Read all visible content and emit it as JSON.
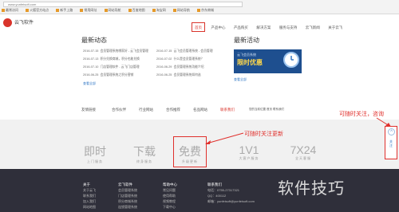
{
  "browser": {
    "url": "www.yunfeisoft.com",
    "bookmarks": [
      "最常访问",
      "火狐官方站点",
      "新手上路",
      "常用网址",
      "网站导航",
      "百度地图",
      "淘宝网",
      "网站导航",
      "京东商城",
      "网址大全",
      "收藏夹栏",
      "网址合集",
      "网上都在",
      "美乐乐中国-专业..."
    ]
  },
  "header": {
    "logo_text": "云飞软件",
    "nav": [
      "首页",
      "产品中心",
      "产品购买",
      "解决方案",
      "服务与支持",
      "云飞新闻",
      "关于云飞"
    ],
    "top_links": [
      "云飞客服",
      "收藏云飞"
    ]
  },
  "news": {
    "title": "最新动态",
    "items": [
      {
        "date": "2016-07-15",
        "text": "会员管理系统哪家好 - 云飞会员管理"
      },
      {
        "date": "2016-07-13",
        "text": "积分兑换商城，积分也能兑换"
      },
      {
        "date": "2016-07-10",
        "text": "门店管理软件 - 云飞门店管理"
      },
      {
        "date": "2016-06-25",
        "text": "会员管理系统之积分营销"
      },
      {
        "date": "2016-07-15",
        "text": "云飞会员管理系统 - 会员管理"
      },
      {
        "date": "2016-07-02",
        "text": "什么是会员管理系统？"
      },
      {
        "date": "2016-06-29",
        "text": "会员管理系统功能介绍"
      },
      {
        "date": "2016-06-25",
        "text": "会员管理系统如何选"
      }
    ],
    "more": "查看全部"
  },
  "activity": {
    "title": "最新活动",
    "banner_top": "云飞会员系统",
    "banner_main": "限时优惠",
    "more": "查看全部"
  },
  "links": [
    "友情链接",
    "合作伙伴",
    "行业网站",
    "合作推荐",
    "名品网站",
    "联系我们"
  ],
  "links_right": "您的当前位置 首页 联系我们",
  "features": [
    {
      "big": "即时",
      "small": "上门服务"
    },
    {
      "big": "下载",
      "small": "终身服务"
    },
    {
      "big": "免费",
      "small": "升级更新"
    },
    {
      "big": "1V1",
      "small": "大客户服务"
    },
    {
      "big": "7X24",
      "small": "全天客服"
    }
  ],
  "footer": {
    "cols": [
      {
        "h": "关于",
        "items": [
          "关于云飞",
          "联系我们",
          "加入我们",
          "网站地图"
        ]
      },
      {
        "h": "云飞软件",
        "items": [
          "会员管理系统",
          "门店管理系统",
          "积分商城系统",
          "连锁管理系统"
        ]
      },
      {
        "h": "帮助中心",
        "items": [
          "常见问题",
          "使用帮助",
          "视频教程",
          "下载中心"
        ]
      },
      {
        "h": "联系我们",
        "items": [
          "电话：0755-27317321",
          "QQ：400112",
          "邮箱：yunfeisoft@yunfeisoft.com"
        ]
      }
    ]
  },
  "annotations": {
    "side": "可随时关注，咨询",
    "middle": "可随时关注更新"
  },
  "sidebar": {
    "label": "关注"
  },
  "watermark": "软件技巧"
}
